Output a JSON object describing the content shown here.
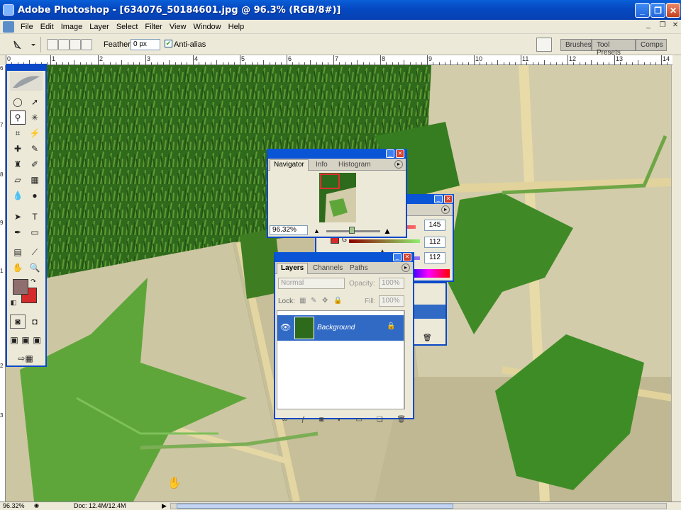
{
  "window": {
    "title": "Adobe Photoshop - [634076_50184601.jpg @ 96.3% (RGB/8#)]"
  },
  "menu": [
    "File",
    "Edit",
    "Image",
    "Layer",
    "Select",
    "Filter",
    "View",
    "Window",
    "Help"
  ],
  "options": {
    "feather_label": "Feather:",
    "feather_value": "0 px",
    "antialias_label": "Anti-alias",
    "antialias_checked": true
  },
  "dock_tabs": [
    "Brushes",
    "Tool Presets",
    "Comps"
  ],
  "ruler": {
    "h": [
      "0",
      "1",
      "2",
      "3",
      "4",
      "5",
      "6",
      "7",
      "8",
      "9",
      "10",
      "11",
      "12",
      "13",
      "14"
    ],
    "v": [
      "6",
      "7",
      "8",
      "9",
      "1",
      "2",
      "3"
    ]
  },
  "navigator": {
    "tabs": [
      "Navigator",
      "Info",
      "Histogram"
    ],
    "zoom": "96.32%"
  },
  "color": {
    "values": [
      "145",
      "112",
      "112"
    ],
    "g_label": "G"
  },
  "layers": {
    "tabs": [
      "Layers",
      "Channels",
      "Paths"
    ],
    "blend_mode": "Normal",
    "opacity_label": "Opacity:",
    "opacity": "100%",
    "lock_label": "Lock:",
    "fill_label": "Fill:",
    "fill": "100%",
    "layer_name": "Background"
  },
  "status": {
    "zoom": "96.32%",
    "doc": "Doc: 12.4M/12.4M"
  },
  "colors": {
    "foreground": "#8e6f6e",
    "background": "#d42b2b",
    "accent": "#0a48c8",
    "selection": "#316ac5"
  }
}
